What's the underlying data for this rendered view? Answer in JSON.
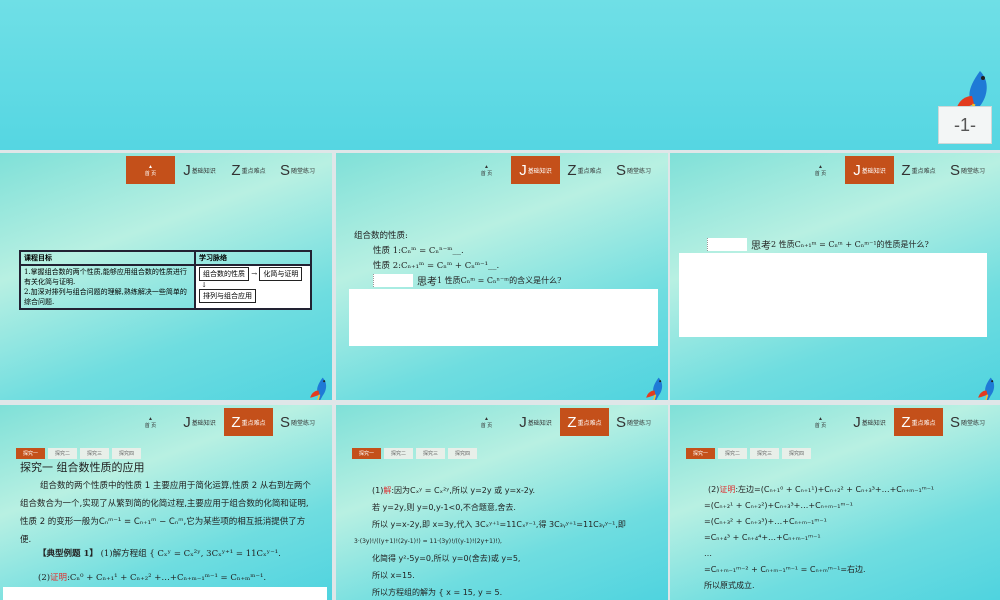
{
  "top_slide": {
    "page_number": "-1-"
  },
  "nav": {
    "home": "首 页",
    "j": {
      "letter": "J",
      "label": "基础知识"
    },
    "z": {
      "letter": "Z",
      "label": "重点难点"
    },
    "s": {
      "letter": "S",
      "label": "随堂练习"
    }
  },
  "tabs": [
    "探究一",
    "探究二",
    "探究三",
    "探究四"
  ],
  "slide1": {
    "col1": "课程目标",
    "col2": "学习脉络",
    "goal1": "1.掌握组合数的两个性质,能够应用组合数的性质进行有关化简与证明.",
    "goal2": "2.加深对排列与组合问题的理解,熟练解决一些简单的综合问题.",
    "box1": "组合数的性质",
    "box2": "化简与证明",
    "box3": "排列与组合应用"
  },
  "slide2": {
    "heading": "组合数的性质:",
    "p1": "性质 1:Cₙᵐ = Cₙⁿ⁻ᵐ__.",
    "p2": "性质 2:Cₙ₊₁ᵐ = Cₙᵐ + Cₙᵐ⁻¹__.",
    "think_label": "思考",
    "think": " 1 性质Cₙᵐ = Cₙⁿ⁻ᵐ的含义是什么?"
  },
  "slide3": {
    "think_label": "思考",
    "think": " 2 性质Cₙ₊₁ᵐ = Cₙᵐ + Cₙᵐ⁻¹的性质是什么?"
  },
  "slide4": {
    "title": "探究一  组合数性质的应用",
    "para": "组合数的两个性质中的性质 1 主要应用于简化运算,性质 2 从右到左两个组合数合为一个,实现了从繁到简的化简过程,主要应用于组合数的化简和证明,性质 2 的变形一般为Cₙᵐ⁻¹ = Cₙ₊₁ᵐ − Cₙᵐ,它为某些项的相互抵消提供了方便.",
    "example_label": "【典型例题 1】",
    "ex1": "(1)解方程组 { Cₓʸ = Cₓ²ʸ,  3Cₓʸ⁺¹ = 11Cₓʸ⁻¹.",
    "ex2_label": "证明",
    "ex2_pre": "(2)",
    "ex2": ":Cₙ⁰ + Cₙ₊₁¹ + Cₙ₊₂² +…+Cₙ₊ₘ₋₁ᵐ⁻¹ = Cₙ₊ₘᵐ⁻¹."
  },
  "slide5": {
    "lines": [
      "因为Cₓʸ = Cₓ²ʸ,所以 y=2y 或 y=x-2y.",
      "若 y=2y,则 y=0,y-1<0,不合题意,舍去.",
      "所以 y=x-2y,即 x=3y,代入 3Cₓʸ⁺¹=11Cₓʸ⁻¹,得 3C₃ᵧʸ⁺¹=11C₃ᵧʸ⁻¹,即",
      "3·(3y)!/((y+1)!(2y-1)!) = 11·(3y)!/((y-1)!(2y+1)!),",
      "化简得 y²-5y=0,所以 y=0(舍去)或 y=5,",
      "所以 x=15.",
      "所以方程组的解为 { x = 15, y = 5."
    ],
    "pre": "(1)",
    "label": "解"
  },
  "slide6": {
    "pre": "(2)",
    "label": "证明",
    "lines": [
      ":左边=(Cₙ₊₁⁰ + Cₙ₊₁¹)+Cₙ₊₂² + Cₙ₊₃³+…+Cₙ₊ₘ₋₁ᵐ⁻¹",
      "=(Cₙ₊₂¹ + Cₙ₊₂²)+Cₙ₊₃³+…+Cₙ₊ₘ₋₁ᵐ⁻¹",
      "=(Cₙ₊₃² + Cₙ₊₃³)+…+Cₙ₊ₘ₋₁ᵐ⁻¹",
      "=Cₙ₊₄³ + Cₙ₊₄⁴+…+Cₙ₊ₘ₋₁ᵐ⁻¹",
      "…",
      "=Cₙ₊ₘ₋₁ᵐ⁻² + Cₙ₊ₘ₋₁ᵐ⁻¹ = Cₙ₊ₘᵐ⁻¹=右边.",
      "所以原式成立."
    ]
  },
  "colors": {
    "accent": "#c4501a"
  }
}
